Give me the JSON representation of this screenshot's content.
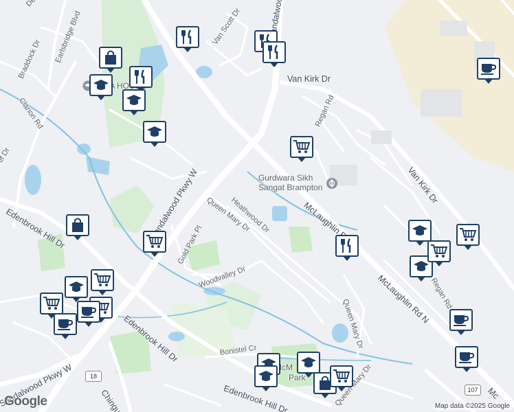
{
  "map": {
    "colors": {
      "background": "#eef0f3",
      "road": "#ffffff",
      "water": "#a9d3ec",
      "park": "#cdebc8",
      "pin_border": "#1f3f66",
      "commercial": "#f3ecd7"
    },
    "street_labels": {
      "devon": "Devon",
      "earlsbridge_blvd": "Earlsbridge Blvd",
      "braddock_dr": "Braddock Dr",
      "clarion_rd": "Clarion Rd",
      "cliff_dr": "iff Dr",
      "van_scott_dr": "Van Scott Dr",
      "sandalwood_top": "Sandalwood Pk",
      "van_kirk_dr_top": "Van Kirk Dr",
      "regan_rd": "Regan Rd",
      "van_kirk_dr_right": "Van Kirk Dr",
      "edenbrook_hill_dr_left": "Edenbrook Hill Dr",
      "sandalwood_pkwy_w": "Sandalwood Pkwy W",
      "queen_mary_dr": "Queen Mary Dr",
      "heathwood_dr": "Heathwood Dr",
      "mclaughlin_rd": "McLaughlin Rd",
      "gold_park_pl": "Gold Park Pl",
      "woodvalley_dr": "Woodvalley Dr",
      "edenbrook_hill_dr_mid": "Edenbrook Hill Dr",
      "mclaughlin_rd_n": "McLaughlin Rd N",
      "regan_rd_right": "Regan Rd",
      "queen_mary_dr_right": "Queen Mary Dr",
      "bonistel_cr": "Bonistel Cr",
      "edenbrook_hill_dr_bottom": "Edenbrook Hill Dr",
      "queen_mary_dr_bottom": "Queen Mary Dr",
      "sandalwood_pkwy_w_bottom": "Sandalwood Pkwy W",
      "chingua": "Chingua",
      "mc_right_edge": "Mc"
    },
    "poi_labels": {
      "gurdwara_line1": "Gurdwara Sikh",
      "gurdwara_line2": "Sangat Brampton",
      "house": "IA     HOUSE",
      "park": "Park",
      "park_prefix": "McM"
    },
    "route_shields": {
      "r18": "18",
      "r107": "107"
    },
    "attribution": "Map data ©2025 Google",
    "logo": "Google"
  }
}
